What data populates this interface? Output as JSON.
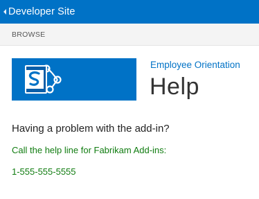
{
  "topbar": {
    "site_link": "Developer Site",
    "back_icon": "chevron-left-icon",
    "background": "#0072c6"
  },
  "ribbon": {
    "tab": "BROWSE"
  },
  "header": {
    "logo_icon": "sharepoint-logo-icon",
    "app_title": "Employee Orientation",
    "page_title": "Help"
  },
  "content": {
    "problem_text": "Having a problem with the add-in?",
    "help_line_text": "Call the help line for Fabrikam Add-ins:",
    "phone_number": "1-555-555-5555",
    "accent_green": "#107c10"
  }
}
